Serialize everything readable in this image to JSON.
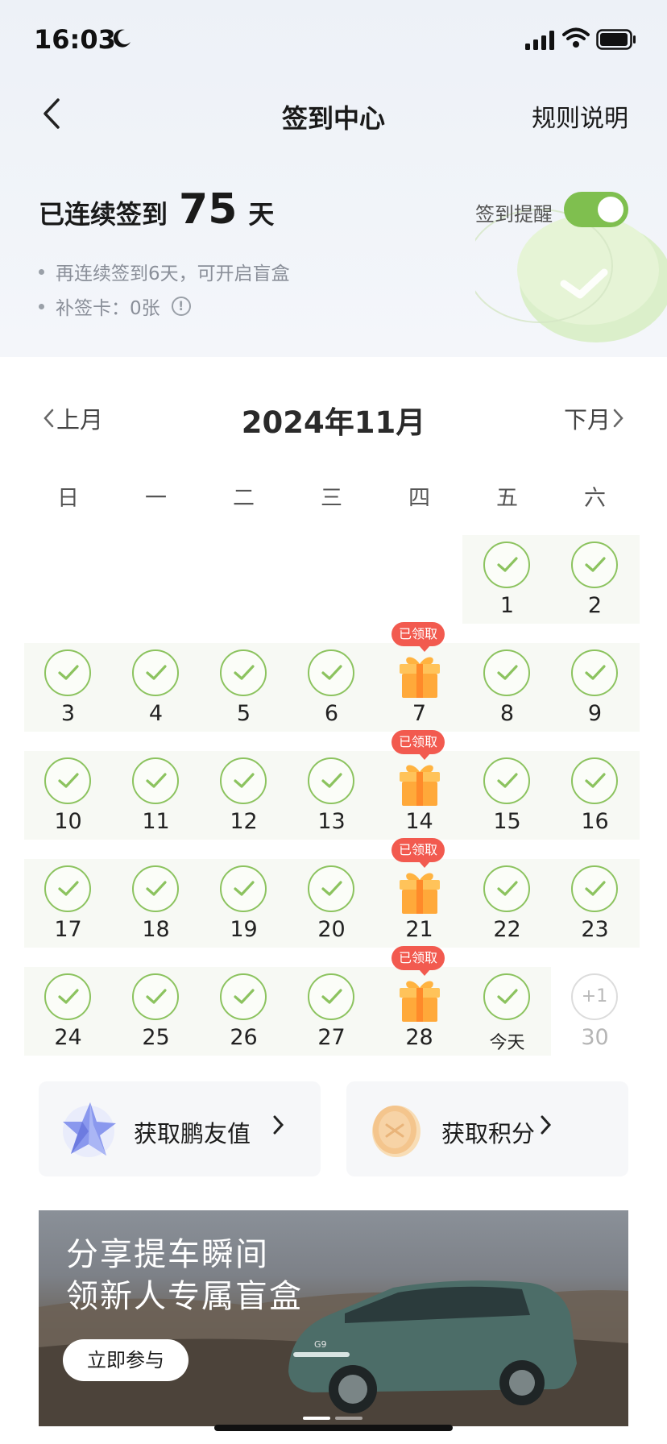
{
  "status": {
    "time": "16:03"
  },
  "header": {
    "title": "签到中心",
    "rules": "规则说明"
  },
  "streak": {
    "prefix": "已连续签到",
    "days": "75",
    "unit": "天"
  },
  "reminder": {
    "label": "签到提醒",
    "on": true
  },
  "tips": [
    "再连续签到6天，可开启盲盒",
    "补签卡：0张"
  ],
  "calendar": {
    "month_title": "2024年11月",
    "prev_label": "上月",
    "next_label": "下月",
    "weekdays": [
      "日",
      "一",
      "二",
      "三",
      "四",
      "五",
      "六"
    ],
    "claimed_badge": "已领取",
    "days": {
      "d1": "1",
      "d2": "2",
      "d3": "3",
      "d4": "4",
      "d5": "5",
      "d6": "6",
      "d7": "7",
      "d8": "8",
      "d9": "9",
      "d10": "10",
      "d11": "11",
      "d12": "12",
      "d13": "13",
      "d14": "14",
      "d15": "15",
      "d16": "16",
      "d17": "17",
      "d18": "18",
      "d19": "19",
      "d20": "20",
      "d21": "21",
      "d22": "22",
      "d23": "23",
      "d24": "24",
      "d25": "25",
      "d26": "26",
      "d27": "27",
      "d28": "28",
      "today": "今天",
      "d30": "30"
    },
    "bonus": "+1"
  },
  "cards": {
    "friend_value": "获取鹏友值",
    "points": "获取积分"
  },
  "banner": {
    "line1": "分享提车瞬间",
    "line2": "领新人专属盲盒",
    "button": "立即参与",
    "car_badge": "G9"
  },
  "colors": {
    "accent_green": "#8cc35f",
    "badge_red": "#f25a4f",
    "toggle_green": "#7fbf4f"
  }
}
